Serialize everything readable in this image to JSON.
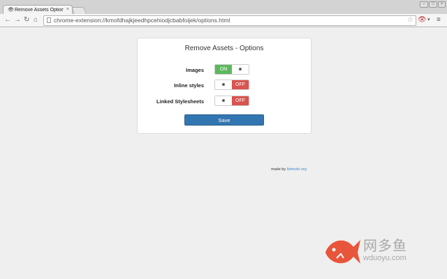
{
  "browser": {
    "tab_title": "Remove Assets Options",
    "tab_close": "×",
    "url": "chrome-extension://kmofdhajkjeedhpcehiodjcbabfoijek/options.html"
  },
  "options": {
    "title": "Remove Assets - Options",
    "rows": [
      {
        "label": "Images",
        "state": "ON"
      },
      {
        "label": "Inline styles",
        "state": "OFF"
      },
      {
        "label": "Linked Stylesheets",
        "state": "OFF"
      }
    ],
    "save_label": "Save"
  },
  "footer": {
    "made_by": "made by",
    "site": "listmole.org"
  },
  "watermark": {
    "cn": "网多鱼",
    "en": "wduoyu.com"
  },
  "colors": {
    "on": "#5cb85c",
    "off": "#d9534f",
    "primary": "#3276b1"
  }
}
